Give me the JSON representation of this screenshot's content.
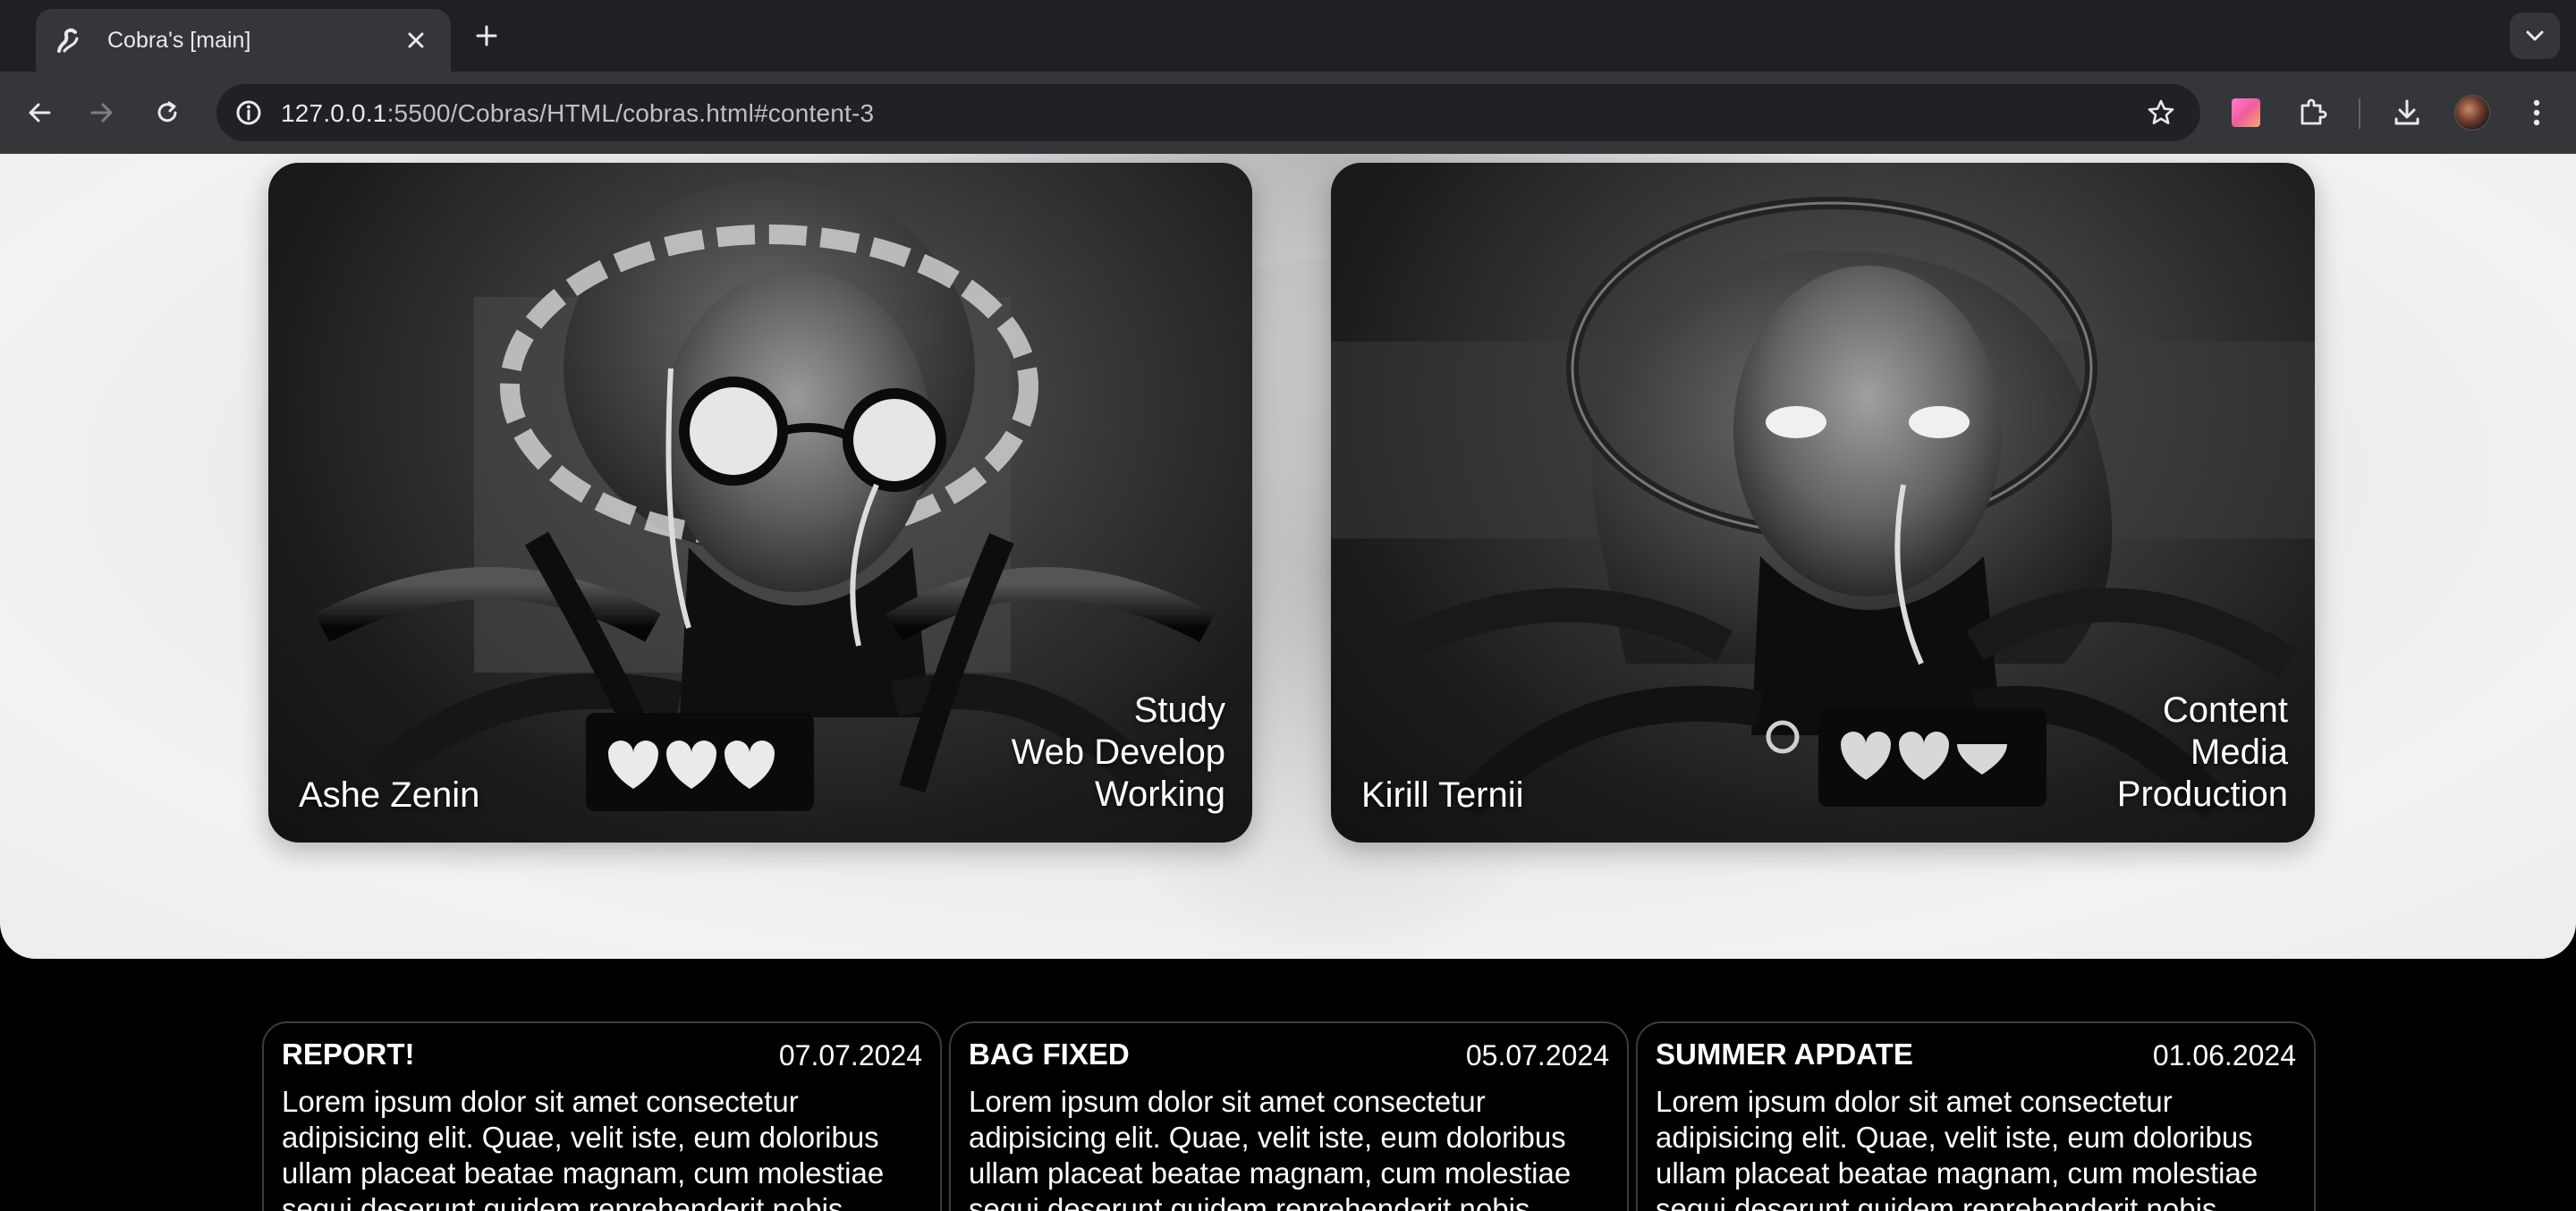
{
  "browser": {
    "tab_title": "Cobra's [main]",
    "url_host": "127.0.0.1",
    "url_path": ":5500/Cobras/HTML/cobras.html#content-3"
  },
  "cards": [
    {
      "name": "Ashe Zenin",
      "roles": [
        "Study",
        "Web Develop",
        "Working"
      ]
    },
    {
      "name": "Kirill Ternii",
      "roles": [
        "Content",
        "Media",
        "Production"
      ]
    }
  ],
  "news": [
    {
      "title": "REPORT!",
      "date": "07.07.2024",
      "body": "Lorem ipsum dolor sit amet consectetur adipisicing elit. Quae, velit iste, eum doloribus ullam placeat beatae magnam, cum molestiae sequi deserunt quidem reprehenderit nobis"
    },
    {
      "title": "BAG FIXED",
      "date": "05.07.2024",
      "body": "Lorem ipsum dolor sit amet consectetur adipisicing elit. Quae, velit iste, eum doloribus ullam placeat beatae magnam, cum molestiae sequi deserunt quidem reprehenderit nobis"
    },
    {
      "title": "SUMMER APDATE",
      "date": "01.06.2024",
      "body": "Lorem ipsum dolor sit amet consectetur adipisicing elit. Quae, velit iste, eum doloribus ullam placeat beatae magnam, cum molestiae sequi deserunt quidem reprehenderit nobis"
    }
  ],
  "icons": {
    "favicon": "cobra-icon",
    "tab_close": "close-icon",
    "new_tab": "plus-icon",
    "tab_search": "chevron-down-icon",
    "back": "arrow-left-icon",
    "forward": "arrow-right-icon",
    "reload": "reload-icon",
    "site_info": "info-icon",
    "bookmark": "star-icon",
    "extension_color": "color-extension-icon",
    "extensions": "puzzle-icon",
    "downloads": "download-icon",
    "profile": "avatar",
    "menu": "kebab-menu-icon"
  }
}
